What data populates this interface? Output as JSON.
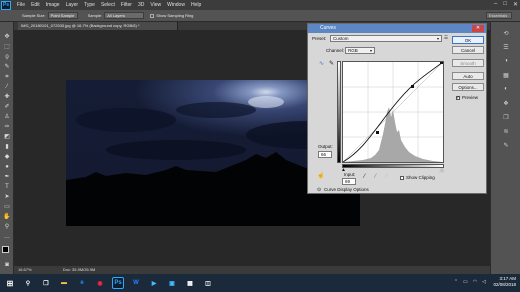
{
  "app": {
    "logo": "Ps",
    "menu": [
      "File",
      "Edit",
      "Image",
      "Layer",
      "Type",
      "Select",
      "Filter",
      "3D",
      "View",
      "Window",
      "Help"
    ],
    "window_controls": [
      "–",
      "□",
      "✕"
    ]
  },
  "options_bar": {
    "sample_size_label": "Sample Size:",
    "sample_size_value": "Point Sample",
    "sample_label": "Sample:",
    "sample_value": "All Layers",
    "show_ring_label": "Show Sampling Ring",
    "workspace": "Essentials"
  },
  "document": {
    "tab_title": "IMG_20180101_072533.jpg @ 16.7% (Background copy, RGB/8) *",
    "zoom": "16.67%",
    "doc_size": "Doc: 35.9M/35.9M"
  },
  "curves": {
    "title": "Curves",
    "close": "✕",
    "preset_label": "Preset:",
    "preset_value": "Custom",
    "channel_label": "Channel:",
    "channel_value": "RGB",
    "output_label": "Output:",
    "output_value": "66",
    "input_label": "Input:",
    "input_value": "69",
    "show_clipping_label": "Show Clipping",
    "display_options_label": "Curve Display Options",
    "buttons": {
      "ok": "OK",
      "cancel": "Cancel",
      "smooth": "Smooth",
      "auto": "Auto",
      "options": "Options..."
    },
    "preview_label": "Preview",
    "preview_checked": true
  },
  "taskbar": {
    "time": "3:17 AM",
    "date": "02/08/2018"
  },
  "colors": {
    "dialog_title": "#5d87c4",
    "taskbar": "#1b2a3a",
    "ps_blue": "#31a8ff"
  }
}
